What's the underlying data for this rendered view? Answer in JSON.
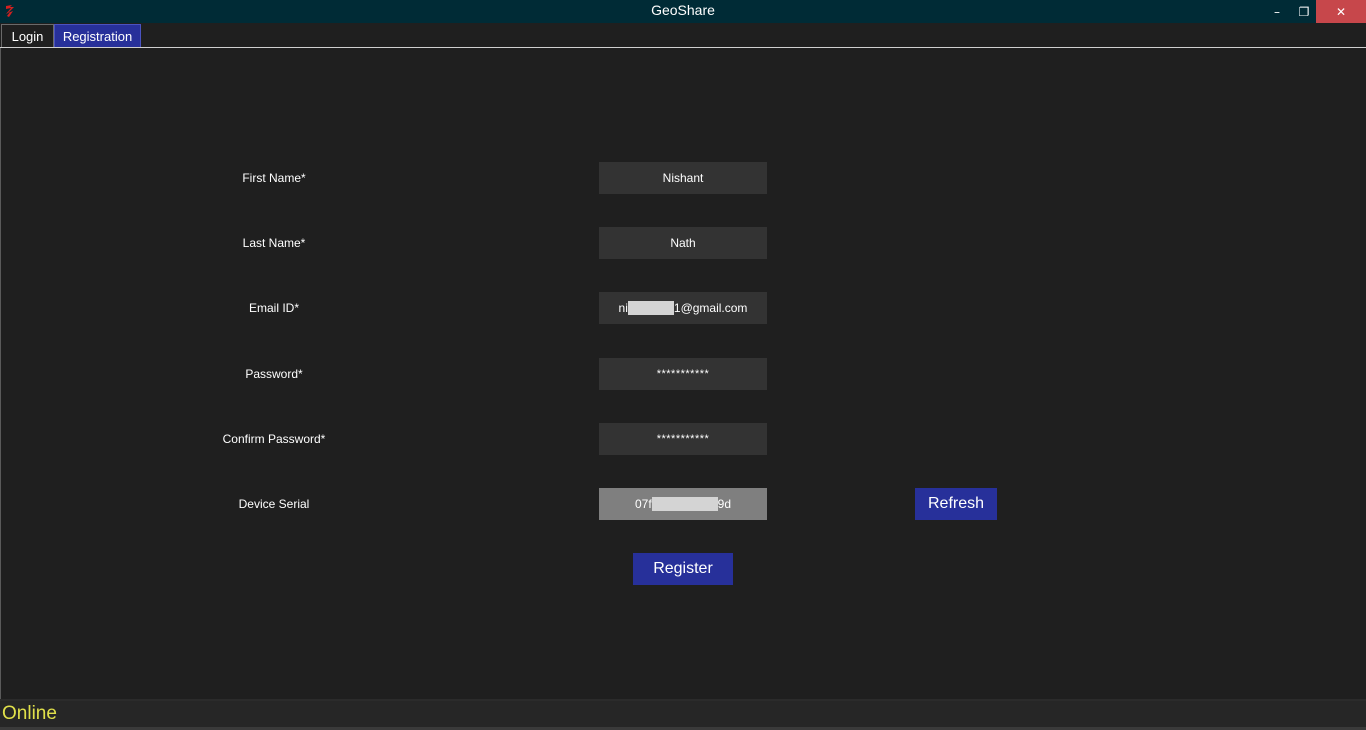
{
  "window": {
    "title": "GeoShare",
    "logo_icon": "tk-feather-icon",
    "minimize_glyph": "–",
    "maximize_glyph": "❐",
    "close_glyph": "✕"
  },
  "tabs": [
    {
      "label": "Login",
      "selected": false
    },
    {
      "label": "Registration",
      "selected": true
    }
  ],
  "form": {
    "first_name": {
      "label": "First Name*",
      "value": "Nishant"
    },
    "last_name": {
      "label": "Last Name*",
      "value": "Nath"
    },
    "email": {
      "label": "Email ID*",
      "value_prefix": "ni",
      "value_suffix": "1@gmail.com"
    },
    "password": {
      "label": "Password*",
      "value": "***********"
    },
    "confirm_password": {
      "label": "Confirm Password*",
      "value": "***********"
    },
    "device_serial": {
      "label": "Device Serial",
      "value_prefix": "07f",
      "value_suffix": "9d"
    }
  },
  "buttons": {
    "refresh": "Refresh",
    "register": "Register"
  },
  "status": {
    "text": "Online",
    "color": "#e0e04a"
  },
  "colors": {
    "accent": "#27309a",
    "background": "#1f1f1f",
    "field": "#333333",
    "title_bar": "#002b36",
    "close_button": "#c7474b"
  }
}
